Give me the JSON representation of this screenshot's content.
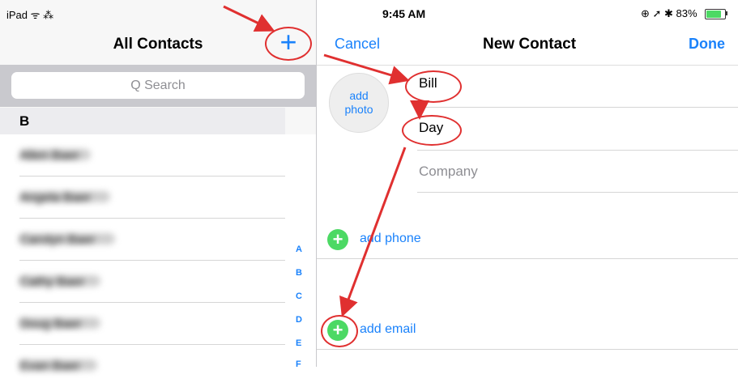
{
  "status_left": "iPad ᯤ ⁂",
  "status_right": {
    "time": "9:45 AM",
    "icons": "⊕ ➚ ✱ 83%",
    "battery_level": 0.83
  },
  "left": {
    "title": "All Contacts",
    "add_icon": "plus-icon",
    "search_placeholder": "Q Search",
    "section_letter": "B",
    "contacts": [
      {
        "name": "Allen Baer"
      },
      {
        "name": "Angela Baer"
      },
      {
        "name": "Carolyn Baer"
      },
      {
        "name": "Cathy Baer"
      },
      {
        "name": "Doug Baer"
      },
      {
        "name": "Evan Baer"
      }
    ],
    "index_letters": [
      "A",
      "B",
      "C",
      "D",
      "E",
      "F"
    ]
  },
  "right": {
    "cancel": "Cancel",
    "title": "New Contact",
    "done": "Done",
    "photo_label_1": "add",
    "photo_label_2": "photo",
    "first_name": "Bill",
    "last_name": "Day",
    "company_placeholder": "Company",
    "add_phone": "add phone",
    "add_email": "add email"
  },
  "colors": {
    "accent": "#1a82fb",
    "add_green": "#4cd964",
    "annotation_red": "#e03030"
  }
}
